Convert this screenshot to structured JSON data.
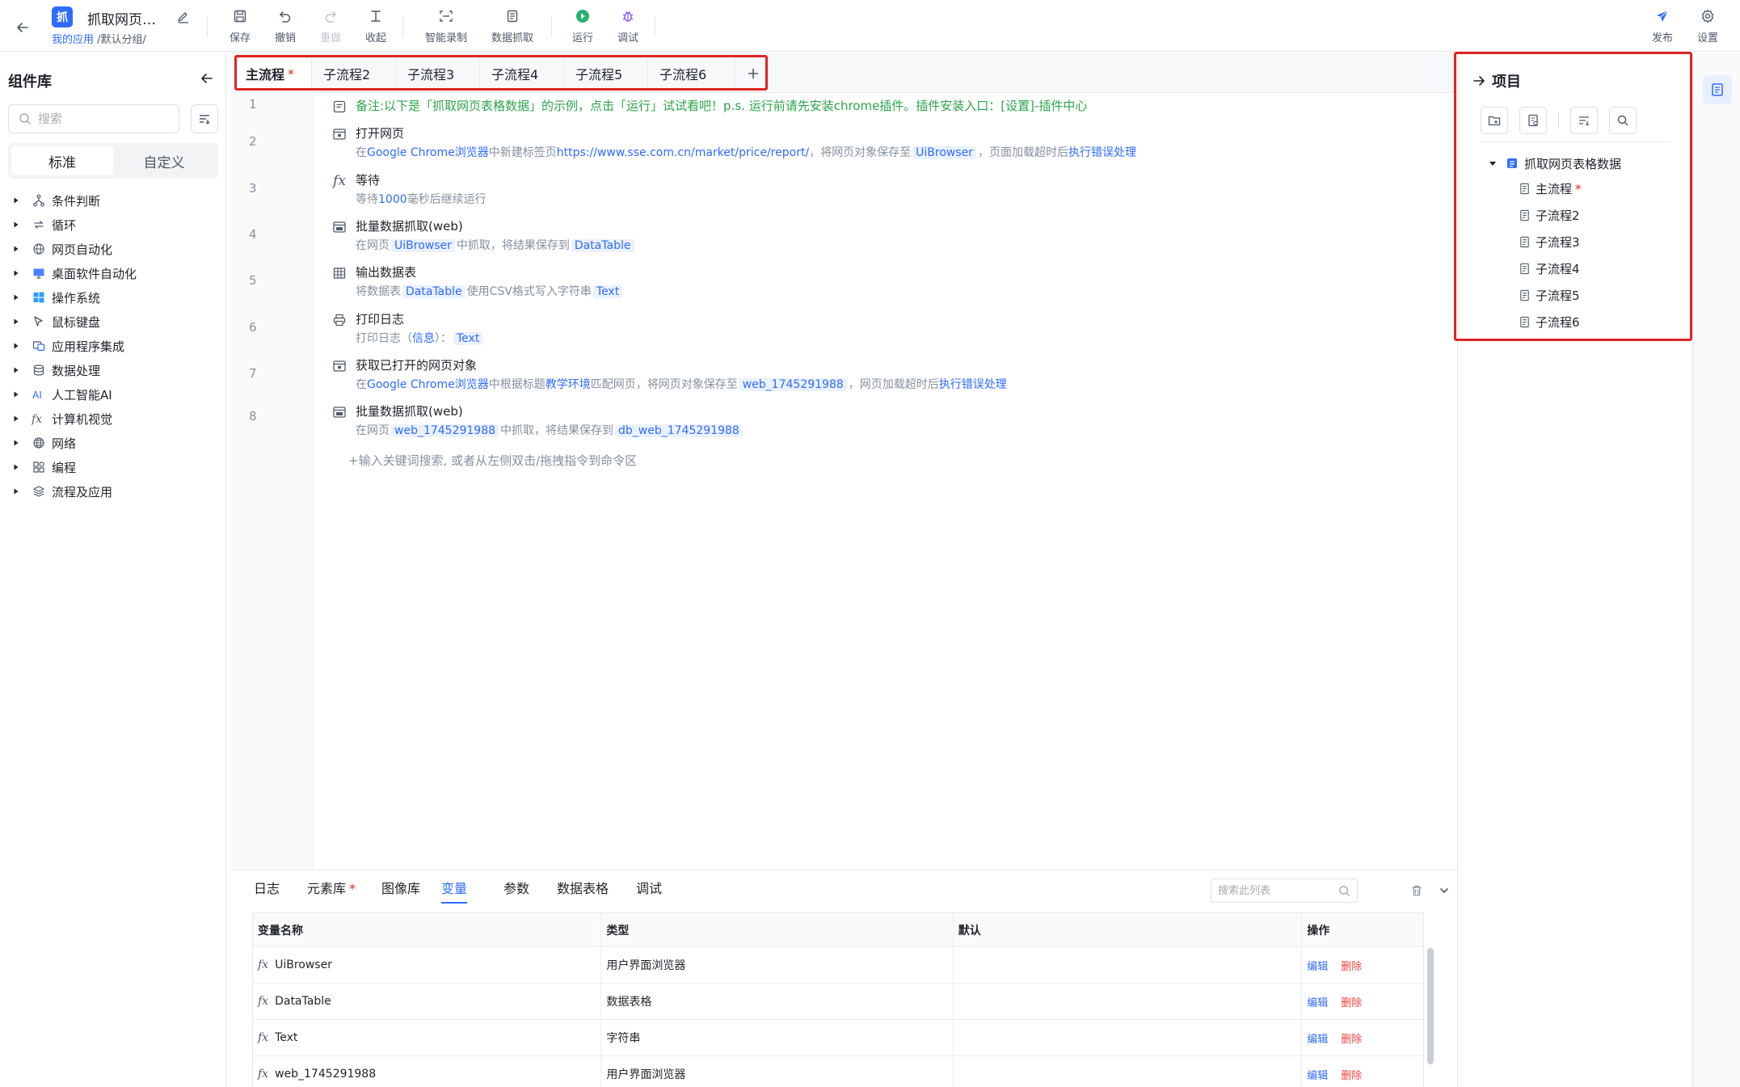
{
  "app": {
    "logo_char": "抓",
    "title": "抓取网页表...",
    "breadcrumb_link": "我的应用",
    "breadcrumb_rest": " /默认分组/"
  },
  "toolbar": {
    "save": "保存",
    "undo": "撤销",
    "redo": "重做",
    "collapse": "收起",
    "smart_record": "智能录制",
    "data_capture": "数据抓取",
    "run": "运行",
    "debug": "调试",
    "publish": "发布",
    "settings": "设置"
  },
  "left_panel": {
    "title": "组件库",
    "search_placeholder": "搜索",
    "segments": [
      "标准",
      "自定义"
    ],
    "categories": [
      {
        "label": "条件判断",
        "icon": "branch-icon"
      },
      {
        "label": "循环",
        "icon": "loop-icon"
      },
      {
        "label": "网页自动化",
        "icon": "globe-cursor-icon"
      },
      {
        "label": "桌面软件自动化",
        "icon": "monitor-icon"
      },
      {
        "label": "操作系统",
        "icon": "windows-icon"
      },
      {
        "label": "鼠标键盘",
        "icon": "mouse-pointer-icon"
      },
      {
        "label": "应用程序集成",
        "icon": "app-integration-icon"
      },
      {
        "label": "数据处理",
        "icon": "database-icon"
      },
      {
        "label": "人工智能AI",
        "icon": "ai-icon"
      },
      {
        "label": "计算机视觉",
        "icon": "fx-icon"
      },
      {
        "label": "网络",
        "icon": "network-globe-icon"
      },
      {
        "label": "编程",
        "icon": "code-blocks-icon"
      },
      {
        "label": "流程及应用",
        "icon": "layers-icon"
      }
    ]
  },
  "tabs": [
    {
      "label": "主流程",
      "star": "*"
    },
    {
      "label": "子流程2"
    },
    {
      "label": "子流程3"
    },
    {
      "label": "子流程4"
    },
    {
      "label": "子流程5"
    },
    {
      "label": "子流程6"
    }
  ],
  "editor": {
    "line_numbers": [
      "1",
      "2",
      "3",
      "4",
      "5",
      "6",
      "7",
      "8"
    ],
    "note": "备注:以下是「抓取网页表格数据」的示例，点击「运行」试试看吧！p.s. 运行前请先安装chrome插件。插件安装入口：[设置]-插件中心",
    "steps": [
      {
        "title": "打开网页",
        "d1": "在",
        "l1": "Google Chrome浏览器",
        "d2": "中新建标签页",
        "l2": "https://www.sse.com.cn/market/price/report/",
        "d3": "，将网页对象保存至",
        "c1": "UiBrowser",
        "d4": "，页面加载超时后",
        "l3": "执行错误处理"
      },
      {
        "title": "等待",
        "d1": "等待",
        "l1": "1000",
        "d2": "毫秒后继续运行"
      },
      {
        "title": "批量数据抓取(web)",
        "d1": "在网页",
        "c1": "UiBrowser",
        "d2": "中抓取，将结果保存到",
        "c2": "DataTable"
      },
      {
        "title": "输出数据表",
        "d1": "将数据表",
        "c1": "DataTable",
        "d2": "使用CSV格式写入字符串",
        "c2": "Text"
      },
      {
        "title": "打印日志",
        "d1": "打印日志（",
        "l1": "信息",
        "d2": "）：",
        "c1": "Text"
      },
      {
        "title": "获取已打开的网页对象",
        "d1": "在",
        "l1": "Google Chrome浏览器",
        "d2": "中根据标题",
        "l2": "教学环境",
        "d3": "匹配网页，将网页对象保存至",
        "c1": "web_1745291988",
        "d4": "，网页加载超时后",
        "l3": "执行错误处理"
      },
      {
        "title": "批量数据抓取(web)",
        "d1": "在网页",
        "c1": "web_1745291988",
        "d2": "中抓取，将结果保存到",
        "c2": "db_web_1745291988"
      }
    ],
    "add_hint": "+输入关键词搜索, 或者从左侧双击/拖拽指令到命令区"
  },
  "bottom": {
    "tabs": [
      {
        "label": "日志"
      },
      {
        "label": "元素库",
        "star": "*"
      },
      {
        "label": "图像库"
      },
      {
        "label": "变量"
      },
      {
        "label": "参数"
      },
      {
        "label": "数据表格"
      },
      {
        "label": "调试"
      }
    ],
    "search_placeholder": "搜索此列表",
    "columns": [
      "变量名称",
      "类型",
      "默认",
      "操作"
    ],
    "rows": [
      {
        "name": "UiBrowser",
        "type": "用户界面浏览器",
        "default": ""
      },
      {
        "name": "DataTable",
        "type": "数据表格",
        "default": ""
      },
      {
        "name": "Text",
        "type": "字符串",
        "default": ""
      },
      {
        "name": "web_1745291988",
        "type": "用户界面浏览器",
        "default": ""
      }
    ],
    "edit_label": "编辑",
    "delete_label": "删除"
  },
  "project": {
    "title": "项目",
    "root": "抓取网页表格数据",
    "items": [
      {
        "label": "主流程",
        "star": "*"
      },
      {
        "label": "子流程2"
      },
      {
        "label": "子流程3"
      },
      {
        "label": "子流程4"
      },
      {
        "label": "子流程5"
      },
      {
        "label": "子流程6"
      }
    ]
  },
  "colors": {
    "accent": "#2f6bff",
    "highlight_box": "#e02424",
    "note_green": "#2ba44a",
    "run_green": "#23b26d",
    "debug_purple": "#8a5cf5"
  }
}
